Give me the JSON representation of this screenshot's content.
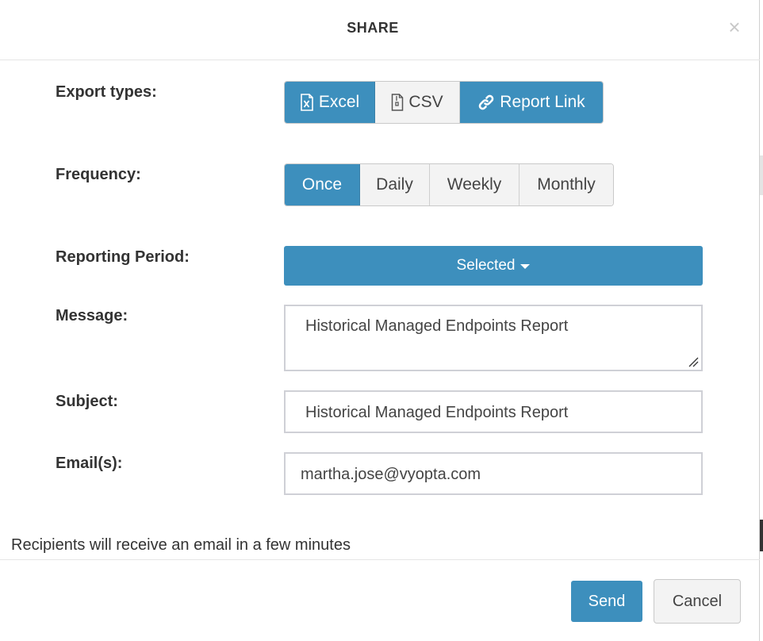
{
  "dialog": {
    "title": "SHARE",
    "close_glyph": "×"
  },
  "export_types": {
    "label": "Export types:",
    "options": [
      {
        "label": "Excel",
        "icon": "file-excel-icon",
        "active": true
      },
      {
        "label": "CSV",
        "icon": "file-zip-icon",
        "active": false
      },
      {
        "label": "Report Link",
        "icon": "link-icon",
        "active": true
      }
    ]
  },
  "frequency": {
    "label": "Frequency:",
    "options": [
      {
        "label": "Once",
        "active": true
      },
      {
        "label": "Daily",
        "active": false
      },
      {
        "label": "Weekly",
        "active": false
      },
      {
        "label": "Monthly",
        "active": false
      }
    ]
  },
  "reporting_period": {
    "label": "Reporting Period:",
    "value": "Selected"
  },
  "message": {
    "label": "Message:",
    "value": "Historical Managed Endpoints Report"
  },
  "subject": {
    "label": "Subject:",
    "value": "Historical Managed Endpoints Report"
  },
  "emails": {
    "label": "Email(s):",
    "value": "martha.jose@vyopta.com"
  },
  "note": "Recipients will receive an email in a few minutes",
  "footer": {
    "send_label": "Send",
    "cancel_label": "Cancel"
  },
  "colors": {
    "primary": "#3d8fbd",
    "button_default": "#f3f3f3"
  }
}
